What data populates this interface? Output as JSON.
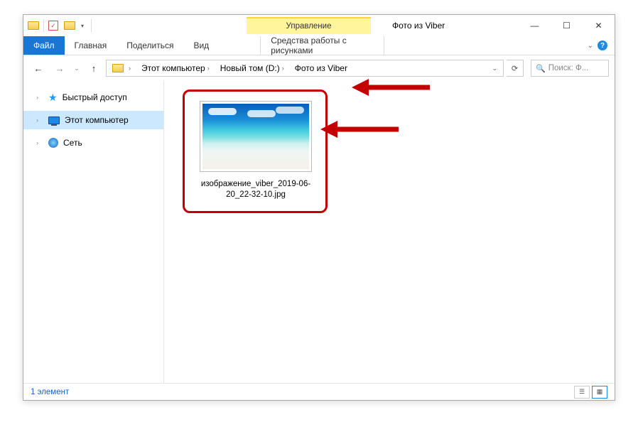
{
  "window": {
    "title": "Фото из Viber",
    "contextual_tab_header": "Управление",
    "contextual_tab_label": "Средства работы с рисунками"
  },
  "ribbon": {
    "file": "Файл",
    "tabs": [
      "Главная",
      "Поделиться",
      "Вид"
    ]
  },
  "breadcrumb": {
    "items": [
      "Этот компьютер",
      "Новый том (D:)",
      "Фото из Viber"
    ]
  },
  "search": {
    "placeholder": "Поиск: Ф..."
  },
  "sidebar": {
    "quick_access": "Быстрый доступ",
    "this_pc": "Этот компьютер",
    "network": "Сеть"
  },
  "file": {
    "name": "изображение_viber_2019-06-20_22-32-10.jpg"
  },
  "statusbar": {
    "count": "1 элемент"
  }
}
